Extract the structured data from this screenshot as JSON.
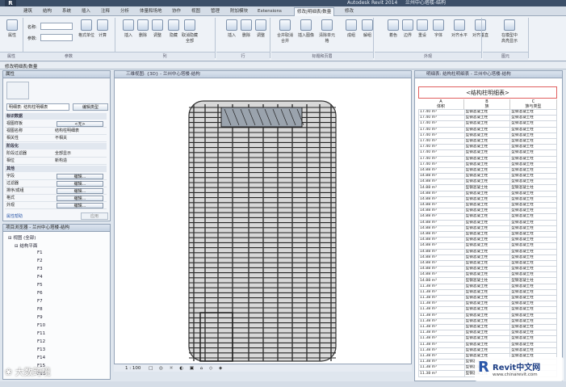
{
  "app": {
    "title": "Autodesk Revit 2014",
    "project": "兰州中心塔楼-结构"
  },
  "tabs": [
    "建筑",
    "结构",
    "系统",
    "插入",
    "注释",
    "分析",
    "体量和场地",
    "协作",
    "视图",
    "管理",
    "附加模块",
    "Extensions",
    "修改|明细表/数量",
    "修改"
  ],
  "active_tab_index": 12,
  "ribbon": {
    "group_labels": [
      "属性",
      "参数",
      "列",
      "行",
      "标题和页眉",
      "外观",
      "图元"
    ],
    "buttons": [
      "属性",
      "格式单位",
      "计算",
      "插入",
      "删除",
      "调整",
      "隐藏",
      "取消隐藏全部",
      "插入",
      "删除",
      "调整",
      "合并取消合并",
      "插入图像",
      "清除单元格",
      "成组",
      "解组",
      "着色",
      "边界",
      "重设",
      "字体",
      "对齐水平",
      "对齐垂直",
      "在模型中高亮显示"
    ],
    "param_labels": [
      "名称:",
      "参数:"
    ]
  },
  "context_bar": "修改明细表/数量",
  "properties": {
    "header": "属性",
    "type_selector": "明细表: 结构柱明细表",
    "edit_type": "编辑类型",
    "section_labels": [
      "标识数据",
      "阶段化",
      "其他"
    ],
    "rows": [
      {
        "key": "视图样板",
        "value": "<无>"
      },
      {
        "key": "视图名称",
        "value": "结构柱明细表"
      },
      {
        "key": "相关性",
        "value": "不相关"
      },
      {
        "key": "阶段过滤器",
        "value": "全部显示"
      },
      {
        "key": "相位",
        "value": "新构造"
      },
      {
        "key": "字段",
        "value": "编辑..."
      },
      {
        "key": "过滤器",
        "value": "编辑..."
      },
      {
        "key": "排序/成组",
        "value": "编辑..."
      },
      {
        "key": "格式",
        "value": "编辑..."
      },
      {
        "key": "外观",
        "value": "编辑..."
      }
    ],
    "help": "属性帮助",
    "apply": "应用"
  },
  "browser": {
    "header": "项目浏览器 - 兰州中心塔楼-结构",
    "root": "视图 (全部)",
    "branch": "结构平面",
    "floors": [
      "F1",
      "F2",
      "F3",
      "F4",
      "F5",
      "F6",
      "F7",
      "F8",
      "F9",
      "F10",
      "F11",
      "F12",
      "F13",
      "F14",
      "F15",
      "F16"
    ]
  },
  "view": {
    "tab_title": "三维视图: {3D} - 兰州中心塔楼-结构",
    "scale": "1 : 100"
  },
  "schedule": {
    "tab_title": "明细表: 结构柱明细表 - 兰州中心塔楼-结构",
    "title": "<结构柱明细表>",
    "col_letters": [
      "A",
      "B",
      "C"
    ],
    "col_names": [
      "体积",
      "族",
      "族与类型"
    ],
    "rows": [
      [
        "17.40 m³",
        "型钢混凝土柱",
        "型钢混凝土柱"
      ],
      [
        "17.40 m³",
        "型钢混凝土柱",
        "型钢混凝土柱"
      ],
      [
        "17.40 m³",
        "型钢混凝土柱",
        "型钢混凝土柱"
      ],
      [
        "17.40 m³",
        "型钢混凝土柱",
        "型钢混凝土柱"
      ],
      [
        "17.40 m³",
        "型钢混凝土柱",
        "型钢混凝土柱"
      ],
      [
        "17.40 m³",
        "型钢混凝土柱",
        "型钢混凝土柱"
      ],
      [
        "17.40 m³",
        "型钢混凝土柱",
        "型钢混凝土柱"
      ],
      [
        "17.40 m³",
        "型钢混凝土柱",
        "型钢混凝土柱"
      ],
      [
        "17.40 m³",
        "型钢混凝土柱",
        "型钢混凝土柱"
      ],
      [
        "17.40 m³",
        "型钢混凝土柱",
        "型钢混凝土柱"
      ],
      [
        "14.88 m³",
        "型钢混凝土柱",
        "型钢混凝土柱"
      ],
      [
        "14.88 m³",
        "型钢混凝土柱",
        "型钢混凝土柱"
      ],
      [
        "14.88 m³",
        "型钢混凝土柱",
        "型钢混凝土柱"
      ],
      [
        "14.88 m³",
        "型钢混凝土柱",
        "型钢混凝土柱"
      ],
      [
        "14.88 m³",
        "型钢混凝土柱",
        "型钢混凝土柱"
      ],
      [
        "14.88 m³",
        "型钢混凝土柱",
        "型钢混凝土柱"
      ],
      [
        "14.88 m³",
        "型钢混凝土柱",
        "型钢混凝土柱"
      ],
      [
        "14.88 m³",
        "型钢混凝土柱",
        "型钢混凝土柱"
      ],
      [
        "14.88 m³",
        "型钢混凝土柱",
        "型钢混凝土柱"
      ],
      [
        "14.88 m³",
        "型钢混凝土柱",
        "型钢混凝土柱"
      ],
      [
        "14.88 m³",
        "型钢混凝土柱",
        "型钢混凝土柱"
      ],
      [
        "14.88 m³",
        "型钢混凝土柱",
        "型钢混凝土柱"
      ],
      [
        "14.88 m³",
        "型钢混凝土柱",
        "型钢混凝土柱"
      ],
      [
        "14.88 m³",
        "型钢混凝土柱",
        "型钢混凝土柱"
      ],
      [
        "14.88 m³",
        "型钢混凝土柱",
        "型钢混凝土柱"
      ],
      [
        "14.88 m³",
        "型钢混凝土柱",
        "型钢混凝土柱"
      ],
      [
        "14.88 m³",
        "型钢混凝土柱",
        "型钢混凝土柱"
      ],
      [
        "14.88 m³",
        "型钢混凝土柱",
        "型钢混凝土柱"
      ],
      [
        "14.88 m³",
        "型钢混凝土柱",
        "型钢混凝土柱"
      ],
      [
        "14.88 m³",
        "型钢混凝土柱",
        "型钢混凝土柱"
      ],
      [
        "11.38 m³",
        "型钢混凝土柱",
        "型钢混凝土柱"
      ],
      [
        "11.38 m³",
        "型钢混凝土柱",
        "型钢混凝土柱"
      ],
      [
        "11.38 m³",
        "型钢混凝土柱",
        "型钢混凝土柱"
      ],
      [
        "11.38 m³",
        "型钢混凝土柱",
        "型钢混凝土柱"
      ],
      [
        "11.38 m³",
        "型钢混凝土柱",
        "型钢混凝土柱"
      ],
      [
        "11.38 m³",
        "型钢混凝土柱",
        "型钢混凝土柱"
      ],
      [
        "11.38 m³",
        "型钢混凝土柱",
        "型钢混凝土柱"
      ],
      [
        "11.38 m³",
        "型钢混凝土柱",
        "型钢混凝土柱"
      ],
      [
        "11.38 m³",
        "型钢混凝土柱",
        "型钢混凝土柱"
      ],
      [
        "11.38 m³",
        "型钢混凝土柱",
        "型钢混凝土柱"
      ],
      [
        "11.38 m³",
        "型钢混凝土柱",
        "型钢混凝土柱"
      ],
      [
        "11.38 m³",
        "型钢混凝土柱",
        "型钢混凝土柱"
      ],
      [
        "11.38 m³",
        "型钢混凝土柱",
        "型钢混凝土柱"
      ],
      [
        "11.38 m³",
        "型钢混凝土柱",
        "型钢混凝土柱"
      ],
      [
        "11.38 m³",
        "型钢混凝土柱",
        "型钢混凝土柱"
      ],
      [
        "11.38 m³",
        "型钢混凝土柱",
        "型钢混凝土柱"
      ]
    ]
  },
  "watermark_left": "大数跨境",
  "watermark_right": {
    "logo": "Revit中文网",
    "url": "www.chinarevit.com"
  },
  "colors": {
    "accent": "#3c4f68",
    "schedule_title_border": "#e06060"
  }
}
